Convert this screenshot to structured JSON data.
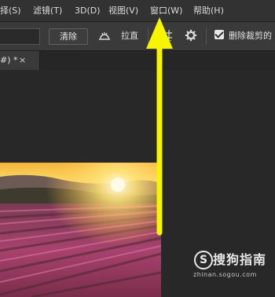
{
  "menubar": {
    "items": [
      {
        "label": "选择(S)",
        "display": "择(S)"
      },
      {
        "label": "滤镜(T)"
      },
      {
        "label": "3D(D)"
      },
      {
        "label": "视图(V)"
      },
      {
        "label": "窗口(W)"
      },
      {
        "label": "帮助(H)"
      }
    ]
  },
  "options": {
    "clear_label": "清除",
    "straighten_label": "拉直",
    "delete_cropped_label": "删除裁剪的",
    "delete_cropped_checked": true
  },
  "document_tab": {
    "label": "#) *",
    "close_glyph": "×"
  },
  "watermark": {
    "logo_glyph": "S",
    "name": "搜狗指南",
    "url": "zhinan.sogou.com"
  },
  "colors": {
    "arrow": "#f5f500",
    "menubar": "#323232",
    "optionsbar": "#3a3a3a",
    "workspace": "#282828"
  }
}
